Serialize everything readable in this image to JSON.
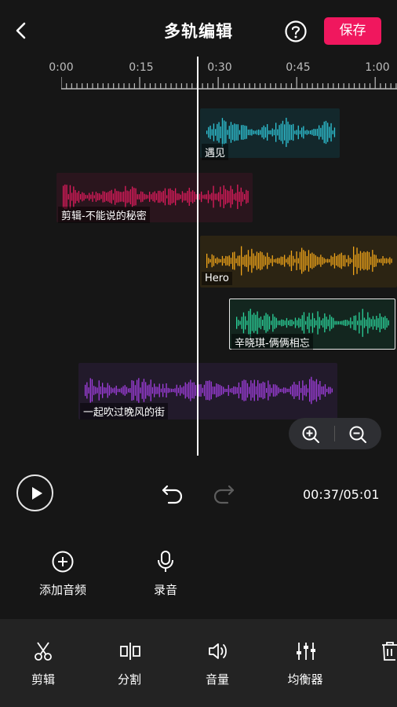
{
  "header": {
    "title": "多轨编辑",
    "save_label": "保存"
  },
  "ruler": {
    "ticks": [
      "0:00",
      "0:15",
      "0:30",
      "0:45",
      "1:00"
    ]
  },
  "tracks": [
    {
      "label": "遇见",
      "color": "#2fc6d8"
    },
    {
      "label": "剪辑-不能说的秘密",
      "color": "#e21c5e"
    },
    {
      "label": "Hero",
      "color": "#f0a51a"
    },
    {
      "label": "辛晓琪-俩俩相忘",
      "color": "#2bd39a"
    },
    {
      "label": "一起吹过晚风的街",
      "color": "#a23fe0"
    }
  ],
  "playback": {
    "time": "00:37/05:01"
  },
  "actions": {
    "add_audio": "添加音频",
    "record": "录音"
  },
  "toolbar": {
    "items": [
      "剪辑",
      "分割",
      "音量",
      "均衡器"
    ]
  },
  "icons": [
    "back-icon",
    "help-icon",
    "zoom-in-icon",
    "zoom-out-icon",
    "play-icon",
    "undo-icon",
    "redo-icon",
    "add-icon",
    "mic-icon",
    "scissors-icon",
    "split-icon",
    "volume-icon",
    "equalizer-icon",
    "trash-icon"
  ],
  "colors": {
    "accent": "#f0175e",
    "background": "#161616",
    "toolbar": "#232323"
  }
}
